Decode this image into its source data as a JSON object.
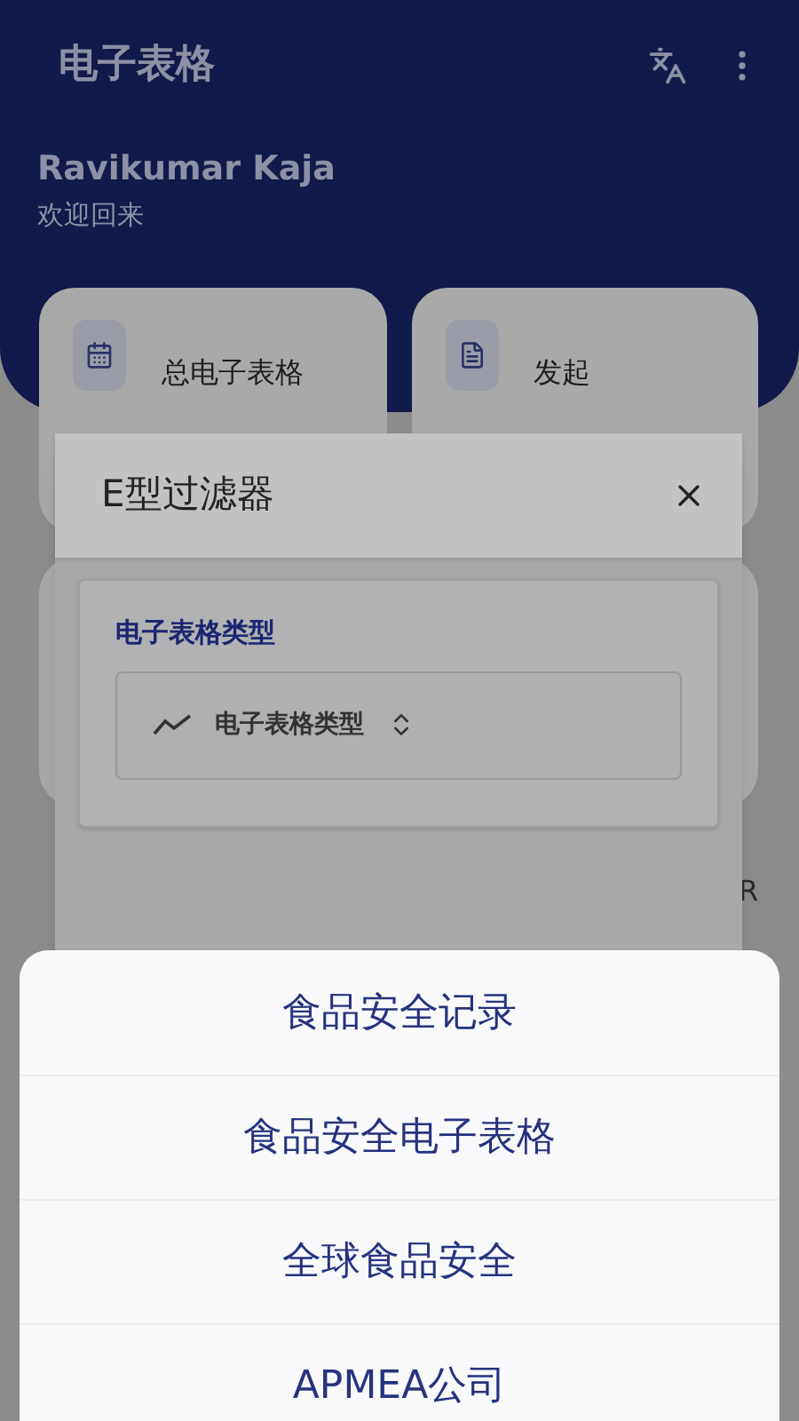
{
  "app_bar": {
    "title": "电子表格"
  },
  "user": {
    "name": "Ravikumar Kaja",
    "greeting": "欢迎回来"
  },
  "tiles": [
    {
      "label": "总电子表格",
      "kind": "calendar"
    },
    {
      "label": "发起",
      "kind": "document"
    }
  ],
  "partial_text": "R",
  "dialog": {
    "title": "E型过滤器",
    "section": {
      "label": "电子表格类型",
      "select": {
        "value": "电子表格类型"
      }
    }
  },
  "action_sheet": {
    "options": [
      "食品安全记录",
      "食品安全电子表格",
      "全球食品安全",
      "APMEA公司"
    ]
  }
}
